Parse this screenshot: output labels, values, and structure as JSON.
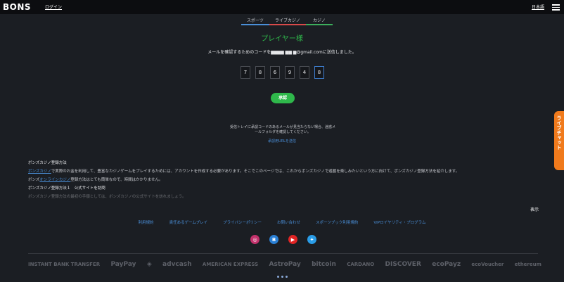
{
  "header": {
    "logo": "BONS",
    "login": "ログイン",
    "lang": "日本語"
  },
  "tabs": [
    "スポーツ",
    "ライブカジノ",
    "カジノ"
  ],
  "verify": {
    "title": "プレイヤー様",
    "message": "メールを確認するためのコードを▆▆▆▆ ▆▆ ▆@gmail.comに送信しました。",
    "digits": [
      "7",
      "8",
      "6",
      "9",
      "4",
      "8"
    ],
    "confirm": "承認",
    "info": "受信トレイに承認コードのあるメールが見当たらない場合、迷惑メールフォルダを確認してください。",
    "resend": "承認用URLを送信"
  },
  "guide": {
    "h1": "ボンズカジノ登録方法",
    "p1_link": "ボンズカジノ",
    "p1": "で実際のお金を利用して、豊富なカジノゲームをプレイするためには、アカウントを作成する必要があります。そこでこのページでは、これからボンズカジノで遊戯を楽しみたいという方に向けて、ボンズカジノ登録方法を紹介します。",
    "p2_pre": "ボンズ",
    "p2_link": "オンラインカジノ",
    "p2": "登録方法はとても簡単なので、時間はかかりません。",
    "h2": "ボンズカジノ登録方法１　公式サイトを訪問",
    "p3": "ボンズカジノ登録方法の最初の手順としては、ボンズカジノの公式サイトを訪れましょう。"
  },
  "show_more": "表示",
  "footer_links": [
    "利用規約",
    "責任あるゲームプレイ",
    "プライバシーポリシー",
    "お問い合わせ",
    "スポーツブック利用規約",
    "VIPロイヤリティ・プログラム"
  ],
  "payments": [
    "INSTANT BANK TRANSFER",
    "PayPay",
    "advcash",
    "AMERICAN EXPRESS",
    "AstroPay",
    "bitcoin",
    "CARDANO",
    "DISCOVER",
    "ecoPayz",
    "ecoVoucher",
    "ethereum"
  ],
  "livechat": "ライブチャット"
}
